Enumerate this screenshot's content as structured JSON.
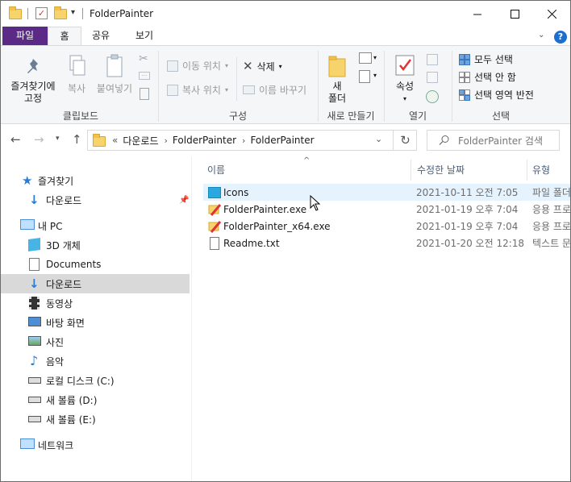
{
  "window": {
    "title": "FolderPainter"
  },
  "ribbon_tabs": [
    "파일",
    "홈",
    "공유",
    "보기"
  ],
  "ribbon": {
    "clipboard": {
      "pin_label_1": "즐겨찾기에",
      "pin_label_2": "고정",
      "copy_label": "복사",
      "paste_label": "붙여넣기",
      "group_label": "클립보드"
    },
    "organize": {
      "move_to": "이동 위치",
      "copy_to": "복사 위치",
      "delete": "삭제",
      "rename": "이름 바꾸기",
      "group_label": "구성"
    },
    "new": {
      "new_folder_1": "새",
      "new_folder_2": "폴더",
      "group_label": "새로 만들기"
    },
    "open": {
      "properties": "속성",
      "group_label": "열기"
    },
    "select": {
      "select_all": "모두 선택",
      "select_none": "선택 안 함",
      "invert": "선택 영역 반전",
      "group_label": "선택"
    }
  },
  "address": {
    "prefix": "«",
    "crumbs": [
      "다운로드",
      "FolderPainter",
      "FolderPainter"
    ]
  },
  "search": {
    "placeholder": "FolderPainter 검색"
  },
  "nav_pane": {
    "items": [
      {
        "label": "즐겨찾기",
        "icon": "star-icon"
      },
      {
        "label": "다운로드",
        "icon": "download-icon"
      },
      {
        "label": "내 PC",
        "icon": "pc-icon"
      },
      {
        "label": "3D 개체",
        "icon": "cube-icon"
      },
      {
        "label": "Documents",
        "icon": "document-icon"
      },
      {
        "label": "다운로드",
        "icon": "download-icon"
      },
      {
        "label": "동영상",
        "icon": "video-icon"
      },
      {
        "label": "바탕 화면",
        "icon": "desktop-icon"
      },
      {
        "label": "사진",
        "icon": "picture-icon"
      },
      {
        "label": "음악",
        "icon": "music-icon"
      },
      {
        "label": "로컬 디스크 (C:)",
        "icon": "drive-icon"
      },
      {
        "label": "새 볼륨 (D:)",
        "icon": "drive-icon"
      },
      {
        "label": "새 볼륨 (E:)",
        "icon": "drive-icon"
      },
      {
        "label": "네트워크",
        "icon": "network-icon"
      }
    ]
  },
  "file_list": {
    "columns": {
      "name": "이름",
      "date": "수정한 날짜",
      "type": "유형"
    },
    "rows": [
      {
        "name": "Icons",
        "date": "2021-10-11 오전 7:05",
        "type": "파일 폴더"
      },
      {
        "name": "FolderPainter.exe",
        "date": "2021-01-19 오후 7:04",
        "type": "응용 프로"
      },
      {
        "name": "FolderPainter_x64.exe",
        "date": "2021-01-19 오후 7:04",
        "type": "응용 프로"
      },
      {
        "name": "Readme.txt",
        "date": "2021-01-20 오전 12:18",
        "type": "텍스트 문"
      }
    ]
  },
  "colors": {
    "file_tab": "#5b2a86",
    "hover_row": "#e5f3ff",
    "selected_nav": "#d9d9d9",
    "accent_blue": "#1c6fcf"
  }
}
